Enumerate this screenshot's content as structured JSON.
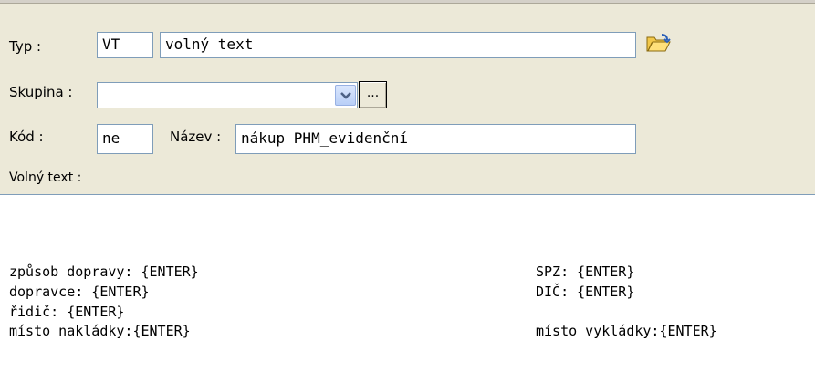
{
  "form": {
    "typ_label": "Typ :",
    "typ_code": "VT",
    "typ_name": "volný text",
    "skupina_label": "Skupina :",
    "skupina_value": "",
    "skupina_browse": "...",
    "kod_label": "Kód :",
    "kod_value": "ne",
    "nazev_label": "Název :",
    "nazev_value": "nákup PHM_evidenční",
    "volny_text_label": "Volný text :"
  },
  "text_area": {
    "left_lines": [
      "způsob dopravy: {ENTER}",
      "dopravce: {ENTER}",
      "řidič: {ENTER}",
      "místo nakládky:{ENTER}"
    ],
    "right_lines": [
      "SPZ: {ENTER}",
      "DIČ: {ENTER}",
      "",
      "místo vykládky:{ENTER}"
    ]
  },
  "icons": {
    "browse": "folder-open-icon",
    "dropdown": "chevron-down-icon"
  },
  "colors": {
    "window_bg": "#ece9d8",
    "input_border": "#7f9db9",
    "dropdown_button": "#b9cff7"
  }
}
